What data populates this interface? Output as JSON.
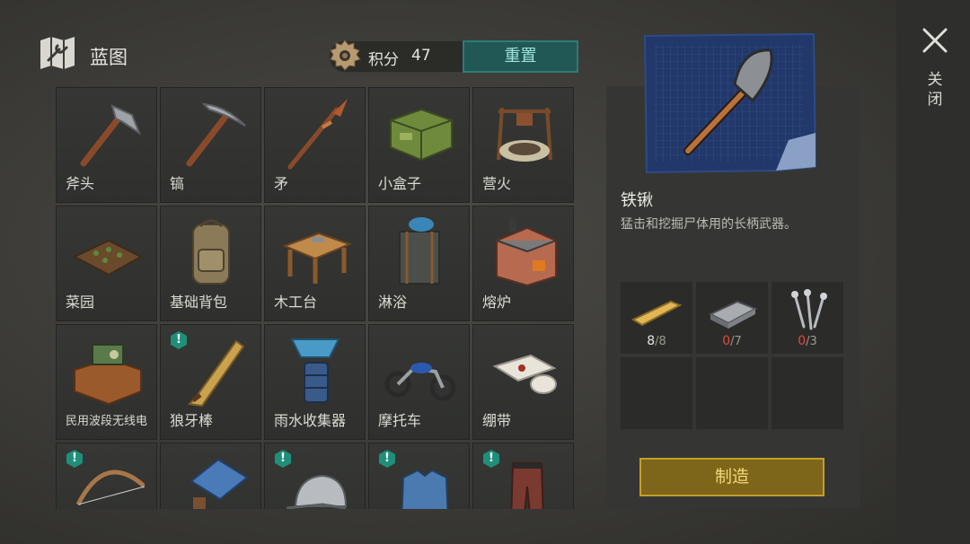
{
  "header": {
    "title": "蓝图",
    "points_label": "积分",
    "points_value": "47",
    "reset_label": "重置"
  },
  "grid": {
    "items": [
      {
        "label": "斧头",
        "icon": "axe-icon",
        "badge": ""
      },
      {
        "label": "镐",
        "icon": "pickaxe-icon",
        "badge": ""
      },
      {
        "label": "矛",
        "icon": "spear-icon",
        "badge": ""
      },
      {
        "label": "小盒子",
        "icon": "crate-icon",
        "badge": ""
      },
      {
        "label": "营火",
        "icon": "campfire-icon",
        "badge": ""
      },
      {
        "label": "菜园",
        "icon": "garden-bed-icon",
        "badge": ""
      },
      {
        "label": "基础背包",
        "icon": "backpack-icon",
        "badge": ""
      },
      {
        "label": "木工台",
        "icon": "workbench-icon",
        "badge": ""
      },
      {
        "label": "淋浴",
        "icon": "shower-icon",
        "badge": ""
      },
      {
        "label": "熔炉",
        "icon": "furnace-icon",
        "badge": ""
      },
      {
        "label": "民用波段无线电",
        "icon": "radio-icon",
        "badge": ""
      },
      {
        "label": "狼牙棒",
        "icon": "spiked-club-icon",
        "badge": "!"
      },
      {
        "label": "雨水收集器",
        "icon": "rain-collector-icon",
        "badge": ""
      },
      {
        "label": "摩托车",
        "icon": "motorcycle-icon",
        "badge": ""
      },
      {
        "label": "绷带",
        "icon": "bandage-icon",
        "badge": ""
      },
      {
        "label": "",
        "icon": "bow-icon",
        "badge": "!"
      },
      {
        "label": "",
        "icon": "doghouse-icon",
        "badge": ""
      },
      {
        "label": "",
        "icon": "cap-icon",
        "badge": "!"
      },
      {
        "label": "",
        "icon": "shirt-icon",
        "badge": "!"
      },
      {
        "label": "",
        "icon": "pants-icon",
        "badge": "!"
      }
    ]
  },
  "detail": {
    "name": "铁锹",
    "description": "猛击和挖掘尸体用的长柄武器。",
    "icon": "shovel-icon",
    "materials": [
      {
        "icon": "wood-plank-icon",
        "have": "8",
        "need": "/8"
      },
      {
        "icon": "iron-ingot-icon",
        "have": "0",
        "need": "/7"
      },
      {
        "icon": "nails-icon",
        "have": "0",
        "need": "/3"
      }
    ],
    "craft_label": "制造"
  },
  "close": {
    "label": "关闭"
  },
  "colors": {
    "reset_teal": "#215855",
    "craft_gold": "#7d6519",
    "badge_green": "#1f8f7a",
    "missing_red": "#e4463a"
  }
}
